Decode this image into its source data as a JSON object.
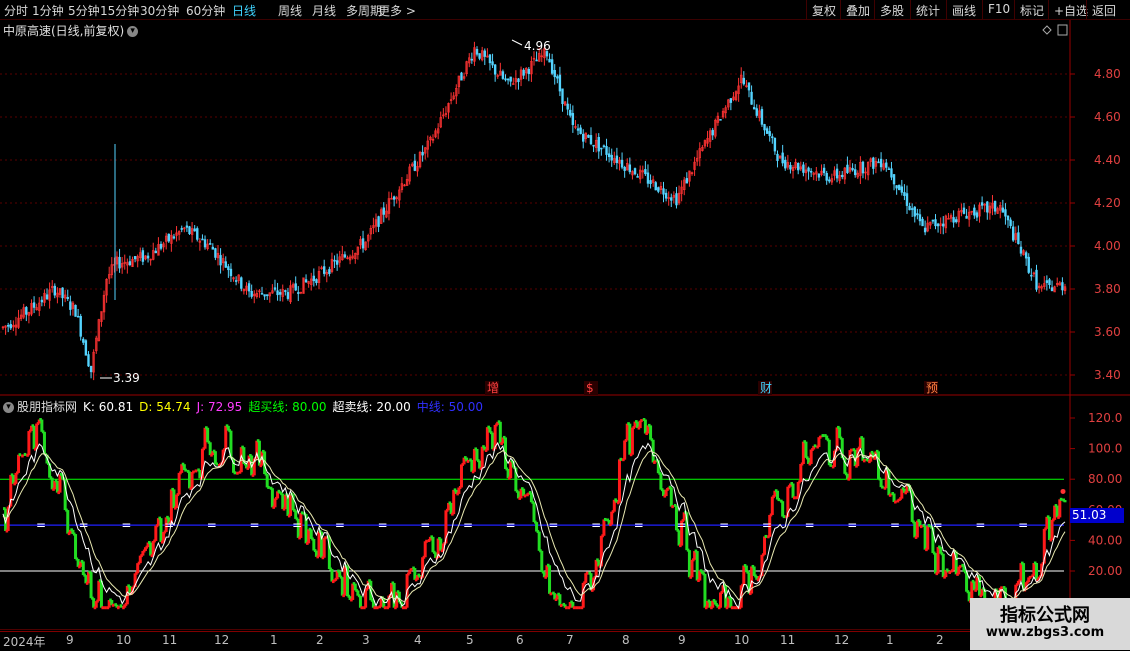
{
  "toolbar": {
    "left": [
      "分时",
      "1分钟",
      "5分钟",
      "15分钟",
      "30分钟",
      "60分钟",
      "日线",
      "周线",
      "月线",
      "多周期",
      "更多 >"
    ],
    "active_index": 6,
    "right": [
      "复权",
      "叠加",
      "多股",
      "统计",
      "画线",
      "F10",
      "标记",
      "+自选",
      "返回"
    ]
  },
  "main": {
    "title": "中原高速(日线,前复权)",
    "price_axis": [
      "4.80",
      "4.60",
      "4.40",
      "4.20",
      "4.00",
      "3.80",
      "3.60",
      "3.40"
    ],
    "high_label": "4.96",
    "low_label": "3.39",
    "events": [
      "增",
      "$",
      "财",
      "预"
    ]
  },
  "indicator": {
    "name": "股朋指标网",
    "k": "K: 60.81",
    "d": "D: 54.74",
    "j": "J: 72.95",
    "overbought": "超买线: 80.00",
    "oversold": "超卖线: 20.00",
    "midline": "中线: 50.00",
    "axis": [
      "120.0",
      "100.0",
      "80.00",
      "60.00",
      "40.00",
      "20.00"
    ],
    "current": "51.03",
    "marker_char": "="
  },
  "date_axis": [
    "2024年",
    "9",
    "10",
    "11",
    "12",
    "1",
    "2",
    "3",
    "4",
    "5",
    "6",
    "7",
    "8",
    "9",
    "10",
    "11",
    "12",
    "1",
    "2"
  ],
  "watermark": {
    "title": "指标公式网",
    "url": "www.zbgs3.com"
  },
  "colors": {
    "up": "#ff3333",
    "down": "#54d4ff",
    "k": "#ffffff",
    "d": "#ffff00",
    "j": "#ff3cff",
    "ob": "#00ff00",
    "os": "#ffffff",
    "mid": "#2020ff",
    "bar_up": "#ff1a1a",
    "bar_dn": "#22dd22"
  }
}
